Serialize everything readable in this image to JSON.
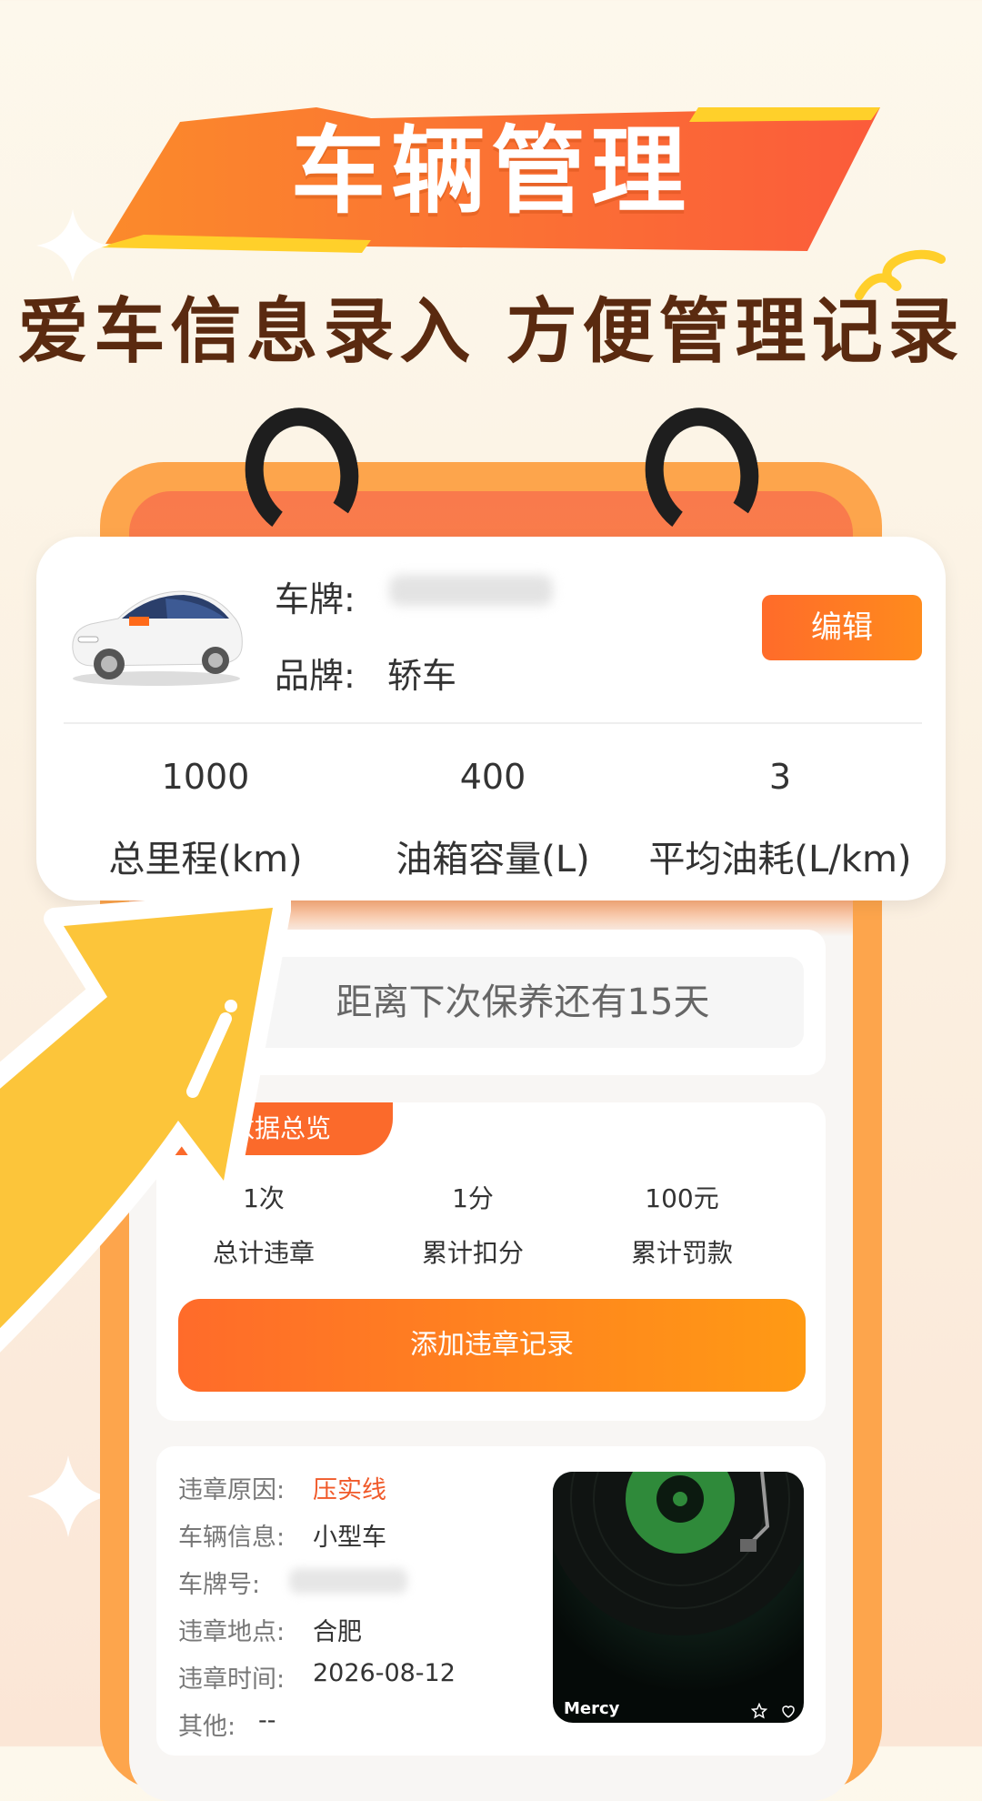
{
  "header": {
    "title": "车辆管理",
    "subtitle": "爱车信息录入 方便管理记录"
  },
  "car_card": {
    "plate_label": "车牌:",
    "brand_label": "品牌:",
    "brand_value": "轿车",
    "edit_label": "编辑",
    "stats": [
      {
        "value": "1000",
        "label": "总里程(km)"
      },
      {
        "value": "400",
        "label": "油箱容量(L)"
      },
      {
        "value": "3",
        "label": "平均油耗(L/km)"
      }
    ]
  },
  "maintenance": {
    "text": "距离下次保养还有15天"
  },
  "violation_summary": {
    "tag": "章数据总览",
    "stats": [
      {
        "value": "1次",
        "label": "总计违章"
      },
      {
        "value": "1分",
        "label": "累计扣分"
      },
      {
        "value": "100元",
        "label": "累计罚款"
      }
    ],
    "add_button": "添加违章记录"
  },
  "record": {
    "fields": [
      {
        "label": "违章原因:",
        "value": "压实线"
      },
      {
        "label": "车辆信息:",
        "value": "小型车"
      },
      {
        "label": "车牌号:",
        "value": ""
      },
      {
        "label": "违章地点:",
        "value": "合肥"
      },
      {
        "label": "违章时间:",
        "value": "2026-08-12"
      },
      {
        "label": "其他:",
        "value": "--"
      }
    ],
    "media_title": "Mercy"
  },
  "colors": {
    "accent": "#ff6b2a",
    "accent_light": "#ff9a14",
    "phone_frame": "#fda54c",
    "subtitle": "#5a2a10",
    "highlight_value": "#f05a2a",
    "arrow": "#fcc53a"
  },
  "icons": [
    "car-image",
    "pointer-arrow",
    "star-icon",
    "heart-icon",
    "vinyl-record-image"
  ]
}
